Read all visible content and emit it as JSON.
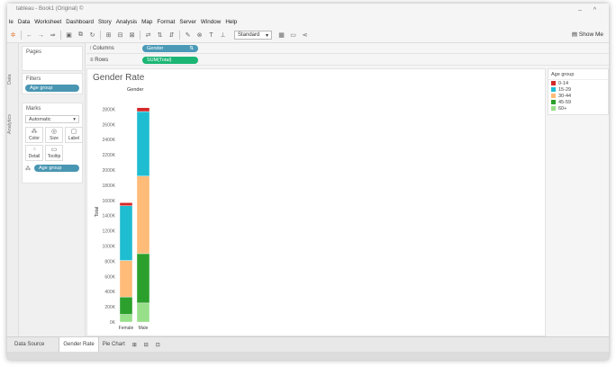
{
  "window": {
    "title": "tableau - Book1 (Original) ©"
  },
  "menu": [
    "le",
    "Data",
    "Worksheet",
    "Dashboard",
    "Story",
    "Analysis",
    "Map",
    "Format",
    "Server",
    "Window",
    "Help"
  ],
  "toolbar": {
    "fit_value": "Standard",
    "show_me_label": "Show Me"
  },
  "left_rail": {
    "data_tab": "Data",
    "analytics_tab": "Analytics"
  },
  "pages_card": {
    "title": "Pages"
  },
  "filters_card": {
    "title": "Filters",
    "pill": "Age group"
  },
  "marks_card": {
    "title": "Marks",
    "type_value": "Automatic",
    "buttons": [
      "Color",
      "Size",
      "Label",
      "Detail",
      "Tooltip"
    ],
    "pill": "Age group"
  },
  "shelves": {
    "columns_label": "Columns",
    "columns_pill": "Gender",
    "rows_label": "Rows",
    "rows_pill": "SUM(Total)"
  },
  "viz": {
    "title": "Gender Rate",
    "column_header": "Gender",
    "yaxis_label": "Total"
  },
  "legend": {
    "title": "Age group",
    "items": [
      {
        "label": "0-14",
        "color": "#d62728"
      },
      {
        "label": "15-29",
        "color": "#1fbdd1"
      },
      {
        "label": "30-44",
        "color": "#ffbb78"
      },
      {
        "label": "45-59",
        "color": "#2ca02c"
      },
      {
        "label": "60+",
        "color": "#98df8a"
      }
    ]
  },
  "chart_data": {
    "type": "bar",
    "stacked": true,
    "title": "Gender Rate",
    "xlabel": "",
    "ylabel": "Total",
    "categories": [
      "Female",
      "Male"
    ],
    "yticks": [
      "0K",
      "200K",
      "400K",
      "600K",
      "800K",
      "1000K",
      "1200K",
      "1400K",
      "1600K",
      "1800K",
      "2000K",
      "2200K",
      "2400K",
      "2600K",
      "2800K"
    ],
    "ylim": [
      0,
      2900000
    ],
    "series": [
      {
        "name": "60+",
        "values": [
          100000,
          250000
        ],
        "color": "#98df8a"
      },
      {
        "name": "45-59",
        "values": [
          230000,
          650000
        ],
        "color": "#2ca02c"
      },
      {
        "name": "30-44",
        "values": [
          480000,
          1020000
        ],
        "color": "#ffbb78"
      },
      {
        "name": "15-29",
        "values": [
          720000,
          850000
        ],
        "color": "#1fbdd1"
      },
      {
        "name": "0-14",
        "values": [
          40000,
          50000
        ],
        "color": "#d62728"
      }
    ],
    "grid": false,
    "legend": "right"
  },
  "tabs": [
    "Data Source",
    "Gender Rate",
    "Pie Chart"
  ],
  "active_tab": "Gender Rate"
}
